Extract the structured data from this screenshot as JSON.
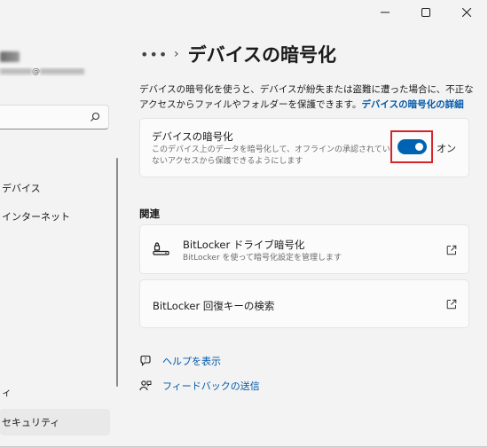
{
  "window": {
    "controls": [
      "minimize",
      "maximize",
      "close"
    ]
  },
  "sidebar": {
    "profile": {
      "email_suffix": "@"
    },
    "search": {
      "placeholder": ""
    },
    "items": [
      {
        "label": "デバイス",
        "active": false
      },
      {
        "label": "インターネット",
        "active": false
      },
      {
        "label": "ィ",
        "active": false
      },
      {
        "label": "セキュリティ",
        "active": true
      }
    ]
  },
  "breadcrumb": {
    "ellipsis": "•••",
    "chevron": "›",
    "title": "デバイスの暗号化"
  },
  "description": {
    "text": "デバイスの暗号化を使うと、デバイスが紛失または盗難に遭った場合に、不正なアクセスからファイルやフォルダーを保護できます。",
    "link": "デバイスの暗号化の詳細"
  },
  "encryption_card": {
    "title": "デバイスの暗号化",
    "subtitle_line1": "このデバイス上のデータを暗号化して、オフラインの承認されてい",
    "subtitle_line2": "ないアクセスから保護できるようにします",
    "toggle_on": true,
    "toggle_label": "オン",
    "accent": "#0063b1",
    "highlight_color": "#d8232a"
  },
  "related": {
    "heading": "関連",
    "items": [
      {
        "title": "BitLocker ドライブ暗号化",
        "subtitle": "BitLocker を使って暗号化設定を管理します",
        "icon": "key-drive-icon"
      },
      {
        "title": "BitLocker 回復キーの検索",
        "subtitle": "",
        "icon": ""
      }
    ]
  },
  "help": {
    "show_help": "ヘルプを表示",
    "feedback": "フィードバックの送信"
  }
}
